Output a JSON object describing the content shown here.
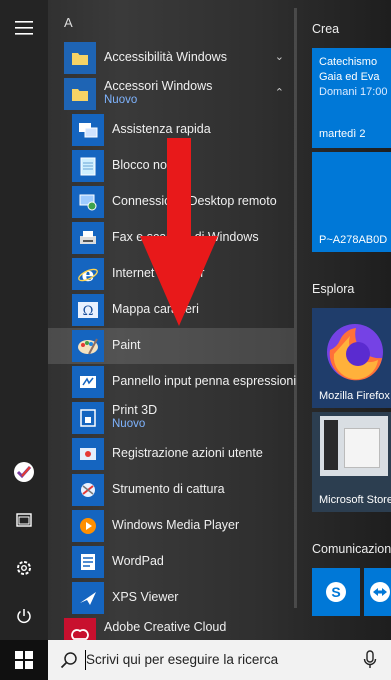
{
  "rail": {
    "menu_icon": "hamburger-icon",
    "items": [
      {
        "name": "office-icon"
      },
      {
        "name": "documents-icon"
      },
      {
        "name": "settings-icon"
      },
      {
        "name": "power-icon"
      }
    ]
  },
  "applist": {
    "letter": "A",
    "apps": [
      {
        "label": "Accessibilità Windows",
        "icon": "folder-icon",
        "chevron": "⌄"
      },
      {
        "label": "Accessori Windows",
        "sub": "Nuovo",
        "icon": "folder-icon",
        "chevron": "⌃"
      },
      {
        "label": "Assistenza rapida",
        "icon": "quick-assist-icon"
      },
      {
        "label": "Blocco note",
        "icon": "notepad-icon"
      },
      {
        "label": "Connessione Desktop remoto",
        "icon": "remote-desktop-icon"
      },
      {
        "label": "Fax e scanner di Windows",
        "icon": "fax-icon"
      },
      {
        "label": "Internet Explorer",
        "icon": "internet-explorer-icon"
      },
      {
        "label": "Mappa caratteri",
        "icon": "character-map-icon"
      },
      {
        "label": "Paint",
        "icon": "paint-icon"
      },
      {
        "label": "Pannello input penna espressioni",
        "icon": "math-input-icon"
      },
      {
        "label": "Print 3D",
        "sub": "Nuovo",
        "icon": "print-3d-icon"
      },
      {
        "label": "Registrazione azioni utente",
        "icon": "steps-recorder-icon"
      },
      {
        "label": "Strumento di cattura",
        "icon": "snipping-tool-icon"
      },
      {
        "label": "Windows Media Player",
        "icon": "media-player-icon"
      },
      {
        "label": "WordPad",
        "icon": "wordpad-icon"
      },
      {
        "label": "XPS Viewer",
        "icon": "xps-viewer-icon"
      },
      {
        "label": "Adobe Creative Cloud",
        "icon": "adobe-cc-icon"
      }
    ]
  },
  "tiles": {
    "group_crea": "Crea",
    "calendar": {
      "line1": "Catechismo",
      "line2": "Gaia ed Eva",
      "line3": "Domani 17:00",
      "day": "martedì 2"
    },
    "mail_tile": {
      "text": "P~A278AB0D"
    },
    "group_esplora": "Esplora",
    "firefox": {
      "label": "Mozilla Firefox"
    },
    "edge": {
      "label": "Microsoft Store"
    },
    "group_comunicazione": "Comunicazione",
    "skype": {
      "name": "skype-icon"
    },
    "teamviewer": {
      "name": "teamviewer-icon"
    }
  },
  "taskbar": {
    "search_placeholder": "Scrivi qui per eseguire la ricerca"
  },
  "annotation": {
    "arrow_color": "#e8191a"
  },
  "colors": {
    "accent": "#0078d7",
    "tile_blue": "#0078d7",
    "new_label": "#7fb4ff"
  }
}
